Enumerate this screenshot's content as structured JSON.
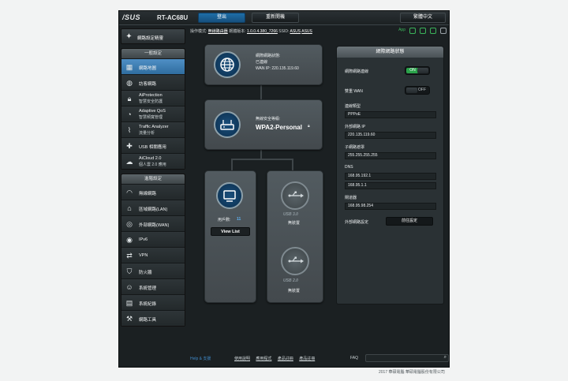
{
  "topbar": {
    "logo": "/SUS",
    "model": "RT-AC68U",
    "logout": "登出",
    "reboot": "重新開機",
    "language": "繁體中文"
  },
  "status": {
    "mode_label": "操作模式:",
    "mode_value": "無線路由器",
    "fw_label": "韌體版本:",
    "fw_value": "1.0.0.4.380_7266",
    "ssid_label": "SSID:",
    "ssid_1": "ASUS",
    "ssid_2": "ASUS",
    "app": "App"
  },
  "sidebar": {
    "quick_setup": "網路設定精靈",
    "general_head": "一般設定",
    "general_items": [
      {
        "label": "網路地圖",
        "sub": "",
        "icon": "network-map-icon",
        "active": true
      },
      {
        "label": "訪客網路",
        "sub": "",
        "icon": "guest-network-icon"
      },
      {
        "label": "AiProtection",
        "sub": "智慧安全防護",
        "icon": "aiprotection-icon"
      },
      {
        "label": "Adaptive QoS",
        "sub": "智慧頻寬管理",
        "icon": "qos-icon"
      },
      {
        "label": "Traffic Analyzer",
        "sub": "流量分析",
        "icon": "traffic-analyzer-icon"
      },
      {
        "label": "USB 相關應用",
        "sub": "",
        "icon": "usb-app-icon"
      },
      {
        "label": "AiCloud 2.0",
        "sub": "個人雲 2.0 應用",
        "icon": "aicloud-icon"
      }
    ],
    "advanced_head": "進階設定",
    "advanced_items": [
      {
        "label": "無線網路",
        "icon": "wireless-icon"
      },
      {
        "label": "區域網路(LAN)",
        "icon": "lan-icon"
      },
      {
        "label": "外部網路(WAN)",
        "icon": "wan-icon"
      },
      {
        "label": "IPv6",
        "icon": "ipv6-icon"
      },
      {
        "label": "VPN",
        "icon": "vpn-icon"
      },
      {
        "label": "防火牆",
        "icon": "firewall-icon"
      },
      {
        "label": "系統管理",
        "icon": "administration-icon"
      },
      {
        "label": "系統紀錄",
        "icon": "system-log-icon"
      },
      {
        "label": "網路工具",
        "icon": "network-tools-icon"
      }
    ]
  },
  "map": {
    "internet_status_label": "網際網路狀態:",
    "internet_status": "已連線",
    "wan_ip": "WAN IP: 220.135.119.60",
    "security_label": "無線安全等級:",
    "security_value": "WPA2-Personal",
    "clients_label": "用戶數:",
    "clients_count": "11",
    "view_list": "View List",
    "usb1_label": "USB 3.0",
    "usb1_status": "無裝置",
    "usb2_label": "USB 2.0",
    "usb2_status": "無裝置"
  },
  "panel": {
    "title": "網際網路狀態",
    "internet_conn_label": "網際網路連線",
    "internet_conn_state": "ON",
    "dual_wan_label": "雙重 WAN",
    "dual_wan_state": "OFF",
    "conn_type_label": "連線類型",
    "conn_type": "PPPoE",
    "wan_ip_label": "外部網路 IP",
    "wan_ip": "220.135.119.60",
    "subnet_label": "子網路遮罩",
    "subnet": "255.255.255.255",
    "dns_label": "DNS",
    "dns1": "168.95.192.1",
    "dns2": "168.95.1.1",
    "gateway_label": "閘道器",
    "gateway": "168.95.98.254",
    "wan_settings_label": "外部網路設定",
    "go_settings": "前往設定"
  },
  "footer": {
    "help": "Help & 支援",
    "links": [
      "使用說明",
      "應用程式",
      "產品註冊",
      "產品註冊"
    ],
    "faq": "FAQ"
  },
  "copyright": "2017 華碩電腦 華碩電腦股份有限公司"
}
